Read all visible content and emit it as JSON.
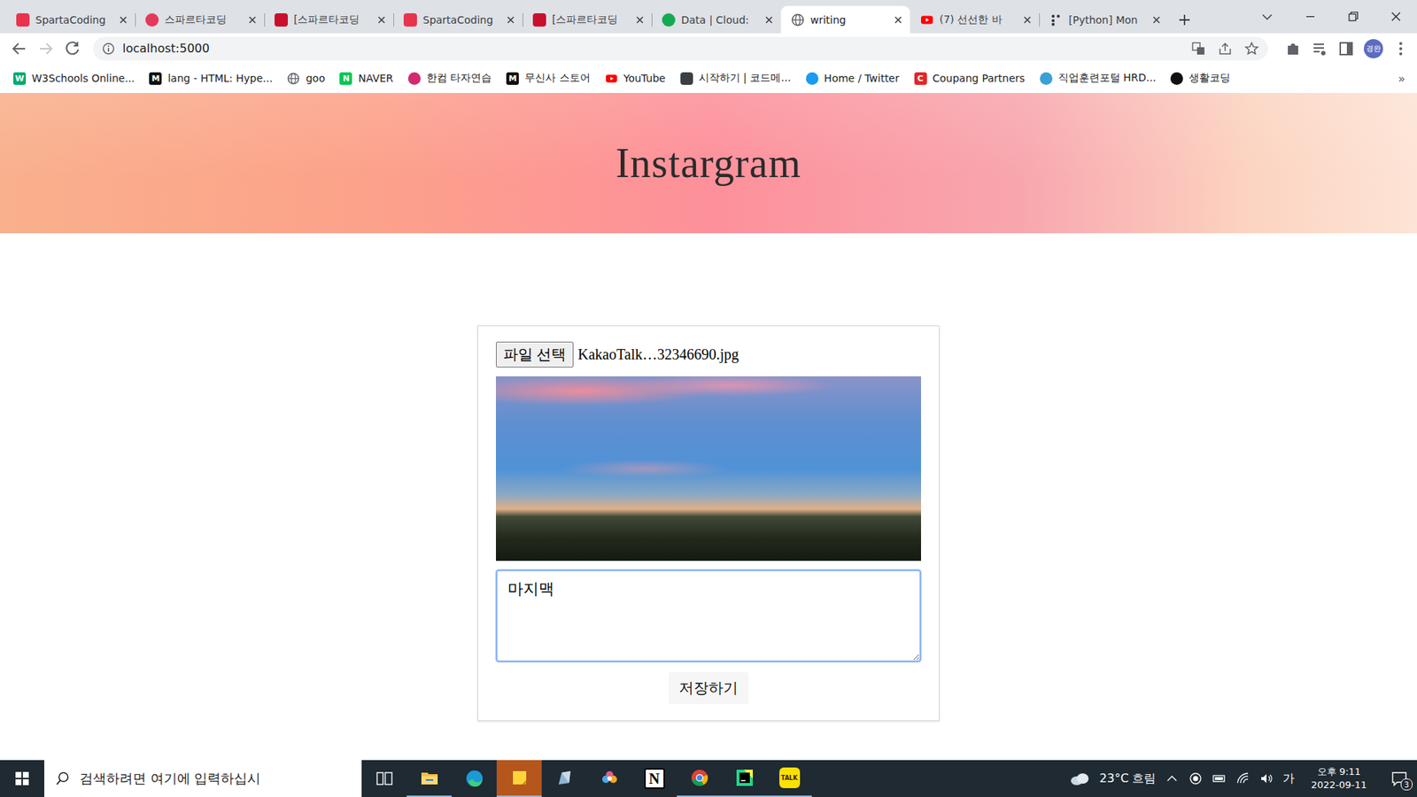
{
  "tabs": [
    {
      "label": "SpartaCoding",
      "selected": false,
      "kind": "badge",
      "color": "#e8344e"
    },
    {
      "label": "스파르타코딩",
      "selected": false,
      "kind": "circle",
      "color": "#e43a5a"
    },
    {
      "label": "[스파르타코딩",
      "selected": false,
      "kind": "badge",
      "color": "#c8102e"
    },
    {
      "label": "SpartaCoding",
      "selected": false,
      "kind": "badge",
      "color": "#e8344e"
    },
    {
      "label": "[스파르타코딩",
      "selected": false,
      "kind": "badge",
      "color": "#c8102e"
    },
    {
      "label": "Data | Cloud:",
      "selected": false,
      "kind": "circle",
      "color": "#13aa52"
    },
    {
      "label": "writing",
      "selected": true,
      "kind": "globe",
      "color": "#5f6368"
    },
    {
      "label": "(7) 선선한 바",
      "selected": false,
      "kind": "play",
      "color": "#ff0000"
    },
    {
      "label": "[Python] Mon",
      "selected": false,
      "kind": "dots",
      "color": "#333333"
    }
  ],
  "toolbar": {
    "url": "localhost:5000",
    "avatar": "경완",
    "forward_disabled": true
  },
  "bookmarks": [
    {
      "label": "W3Schools Online...",
      "kind": "letter",
      "glyph": "W",
      "color": "#04aa6d"
    },
    {
      "label": "lang - HTML: Hype...",
      "kind": "letter",
      "glyph": "M",
      "color": "#111111"
    },
    {
      "label": "goo",
      "kind": "globe",
      "color": "#5f6368"
    },
    {
      "label": "NAVER",
      "kind": "letter",
      "glyph": "N",
      "color": "#03c75a"
    },
    {
      "label": "한컴 타자연습",
      "kind": "circle",
      "color": "#d12a6e"
    },
    {
      "label": "무신사 스토어",
      "kind": "letter",
      "glyph": "M",
      "color": "#111111"
    },
    {
      "label": "YouTube",
      "kind": "play",
      "color": "#ff0000"
    },
    {
      "label": "시작하기 | 코드메...",
      "kind": "square",
      "color": "#3a3f44"
    },
    {
      "label": "Home / Twitter",
      "kind": "circle",
      "color": "#1d9bf0"
    },
    {
      "label": "Coupang Partners",
      "kind": "letter",
      "glyph": "C",
      "color": "#e52528"
    },
    {
      "label": "직업훈련포털 HRD...",
      "kind": "circle",
      "color": "#3aa0d8"
    },
    {
      "label": "생활코딩",
      "kind": "circle",
      "color": "#111111"
    }
  ],
  "bookmarks_more": "»",
  "page": {
    "title": "Instargram",
    "file_button": "파일 선택",
    "file_name": "KakaoTalk…32346690.jpg",
    "text": "마지맥",
    "textarea_focused": true,
    "save_button": "저장하기"
  },
  "taskbar": {
    "search_placeholder": "검색하려면 여기에 입력하십시",
    "apps": [
      {
        "kind": "taskview",
        "active": false,
        "selected": false
      },
      {
        "kind": "explorer",
        "active": true,
        "selected": false
      },
      {
        "kind": "edge",
        "active": false,
        "selected": false
      },
      {
        "kind": "sticky",
        "active": true,
        "selected": true
      },
      {
        "kind": "app",
        "active": false,
        "selected": false
      },
      {
        "kind": "paint",
        "active": false,
        "selected": false
      },
      {
        "kind": "notion",
        "glyph": "N",
        "active": false,
        "selected": false
      },
      {
        "kind": "chrome",
        "active": true,
        "selected": false
      },
      {
        "kind": "pycharm",
        "active": true,
        "selected": false
      },
      {
        "kind": "kakao",
        "glyph": "TALK",
        "active": true,
        "selected": false
      }
    ],
    "weather": "23°C 흐림",
    "ime": "가",
    "time": "오후 9:11",
    "date": "2022-09-11",
    "notifications": "3"
  }
}
